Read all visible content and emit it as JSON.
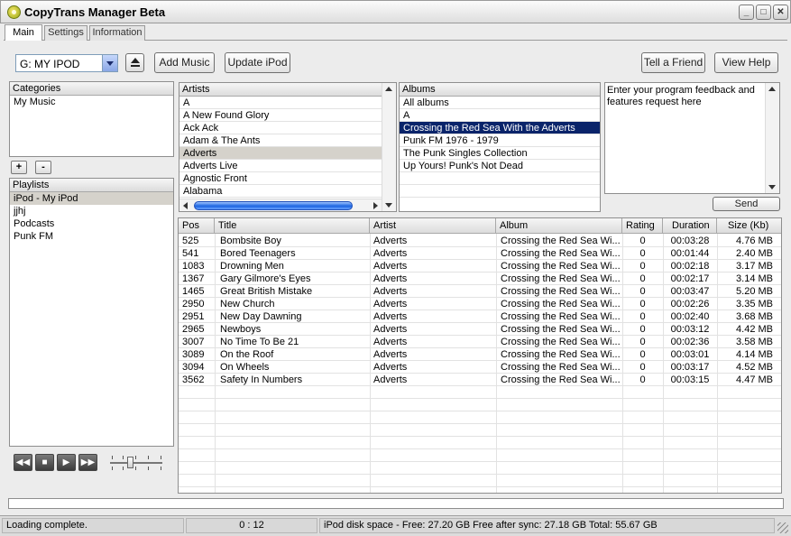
{
  "window": {
    "title": "CopyTrans Manager Beta",
    "min": "_",
    "max": "□",
    "close": "✕"
  },
  "tabs": [
    {
      "label": "Main",
      "active": true
    },
    {
      "label": "Settings",
      "active": false
    },
    {
      "label": "Information",
      "active": false
    }
  ],
  "toolbar": {
    "device": "G: MY IPOD",
    "add_music": "Add Music",
    "update_ipod": "Update iPod",
    "tell_friend": "Tell a Friend",
    "view_help": "View Help"
  },
  "categories": {
    "header": "Categories",
    "items": [
      "My Music"
    ]
  },
  "category_buttons": {
    "add": "+",
    "remove": "-"
  },
  "playlists": {
    "header": "Playlists",
    "items": [
      "iPod - My iPod",
      "jjhj",
      "Podcasts",
      "Punk FM"
    ],
    "selected": 0
  },
  "artists": {
    "header": "Artists",
    "items": [
      "A",
      "A New Found Glory",
      "Ack Ack",
      "Adam & The Ants",
      "Adverts",
      "Adverts Live",
      "Agnostic Front",
      "Alabama"
    ],
    "selected": 4
  },
  "albums": {
    "header": "Albums",
    "items": [
      "All albums",
      "A",
      "Crossing the Red Sea With the Adverts",
      "Punk FM 1976 - 1979",
      "The Punk Singles Collection",
      "Up Yours! Punk's Not Dead"
    ],
    "selected": 2
  },
  "feedback": {
    "text": "Enter your program feedback and features request here",
    "send": "Send"
  },
  "tracks": {
    "columns": [
      "Pos",
      "Title",
      "Artist",
      "Album",
      "Rating",
      "Duration",
      "Size (Kb)"
    ],
    "rows": [
      [
        "525",
        "Bombsite Boy",
        "Adverts",
        "Crossing the Red Sea Wi...",
        "0",
        "00:03:28",
        "4.76 MB"
      ],
      [
        "541",
        "Bored Teenagers",
        "Adverts",
        "Crossing the Red Sea Wi...",
        "0",
        "00:01:44",
        "2.40 MB"
      ],
      [
        "1083",
        "Drowning Men",
        "Adverts",
        "Crossing the Red Sea Wi...",
        "0",
        "00:02:18",
        "3.17 MB"
      ],
      [
        "1367",
        "Gary Gilmore's Eyes",
        "Adverts",
        "Crossing the Red Sea Wi...",
        "0",
        "00:02:17",
        "3.14 MB"
      ],
      [
        "1465",
        "Great British Mistake",
        "Adverts",
        "Crossing the Red Sea Wi...",
        "0",
        "00:03:47",
        "5.20 MB"
      ],
      [
        "2950",
        "New Church",
        "Adverts",
        "Crossing the Red Sea Wi...",
        "0",
        "00:02:26",
        "3.35 MB"
      ],
      [
        "2951",
        "New Day Dawning",
        "Adverts",
        "Crossing the Red Sea Wi...",
        "0",
        "00:02:40",
        "3.68 MB"
      ],
      [
        "2965",
        "Newboys",
        "Adverts",
        "Crossing the Red Sea Wi...",
        "0",
        "00:03:12",
        "4.42 MB"
      ],
      [
        "3007",
        "No Time To Be 21",
        "Adverts",
        "Crossing the Red Sea Wi...",
        "0",
        "00:02:36",
        "3.58 MB"
      ],
      [
        "3089",
        "On the Roof",
        "Adverts",
        "Crossing the Red Sea Wi...",
        "0",
        "00:03:01",
        "4.14 MB"
      ],
      [
        "3094",
        "On Wheels",
        "Adverts",
        "Crossing the Red Sea Wi...",
        "0",
        "00:03:17",
        "4.52 MB"
      ],
      [
        "3562",
        "Safety In Numbers",
        "Adverts",
        "Crossing the Red Sea Wi...",
        "0",
        "00:03:15",
        "4.47 MB"
      ]
    ]
  },
  "player": {
    "prev": "◀◀",
    "stop": "■",
    "play": "▶",
    "next": "▶▶"
  },
  "icons": {
    "app": "copytrans-logo-icon",
    "eject": "eject-icon",
    "dropdown": "chevron-down-icon"
  },
  "progress": {
    "value": 0
  },
  "status": {
    "message": "Loading complete.",
    "time": "0 : 12",
    "disk": "iPod disk space - Free: 27.20 GB Free after sync: 27.18 GB Total: 55.67 GB"
  }
}
